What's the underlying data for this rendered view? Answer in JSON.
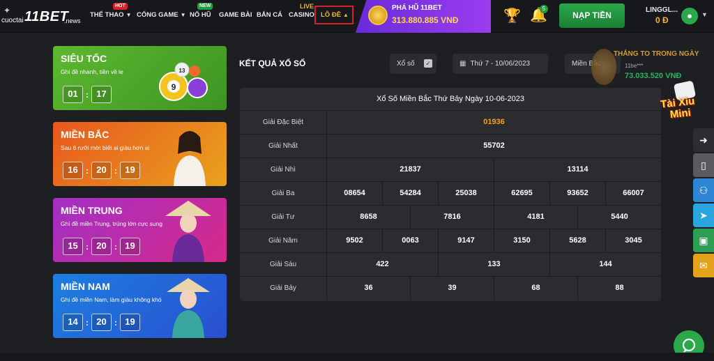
{
  "header": {
    "logo": {
      "prefix": "cuoctai",
      "brand": "11BET",
      "suffix": ".news"
    },
    "nav": [
      {
        "label": "THỂ THAO",
        "badge": "HOT",
        "caret": true
      },
      {
        "label": "CỔNG GAME",
        "caret": true
      },
      {
        "label": "NỔ HŨ",
        "badge": "NEW"
      },
      {
        "label": "GAME BÀI"
      },
      {
        "label": "BẮN CÁ"
      },
      {
        "label": "CASINO",
        "badge": "LIVE"
      },
      {
        "label": "LÔ ĐỀ",
        "caret_up": true,
        "selected": true
      }
    ],
    "jackpot": {
      "title": "PHÁ HŨ 11BET",
      "value": "313.880.885 VNĐ"
    },
    "notifications_count": "5",
    "deposit_label": "NẠP TIỀN",
    "user": {
      "name": "LINGGL...",
      "balance": "0 Đ"
    }
  },
  "regions": [
    {
      "name": "SIÊU TỐC",
      "subtitle": "Ghi đề nhanh, tiền về lẹ",
      "timer": [
        "01",
        "17"
      ],
      "color": "#4ea92a"
    },
    {
      "name": "MIỀN BẮC",
      "subtitle": "Sau 6 rưỡi mời biết ai giàu hơn ai",
      "timer": [
        "16",
        "20",
        "19"
      ],
      "color": "#e8701e"
    },
    {
      "name": "MIỀN TRUNG",
      "subtitle": "Ghi đề miền Trung, trúng lớn cực sung",
      "timer": [
        "15",
        "20",
        "19"
      ],
      "color": "#b42db0"
    },
    {
      "name": "MIỀN NAM",
      "subtitle": "Ghi đề miền Nam, làm giàu không khó",
      "timer": [
        "14",
        "20",
        "19"
      ],
      "color": "#2468d8"
    }
  ],
  "results": {
    "section_title": "KẾT QUẢ XỔ SỐ",
    "filters": {
      "type": "Xổ số",
      "date": "Thứ 7 - 10/06/2023",
      "region": "Miền Bắc"
    },
    "table_title": "Xổ Số Miền Bắc Thứ Bảy Ngày 10-06-2023",
    "rows": [
      {
        "label": "Giải Đặc Biệt",
        "values": [
          "01936"
        ],
        "special": true
      },
      {
        "label": "Giải Nhất",
        "values": [
          "55702"
        ]
      },
      {
        "label": "Giải Nhì",
        "values": [
          "21837",
          "13114"
        ]
      },
      {
        "label": "Giải Ba",
        "values": [
          "08654",
          "54284",
          "25038",
          "62695",
          "93652",
          "66007"
        ]
      },
      {
        "label": "Giải Tư",
        "values": [
          "8658",
          "7816",
          "4181",
          "5440"
        ]
      },
      {
        "label": "Giải Năm",
        "values": [
          "9502",
          "0063",
          "9147",
          "3150",
          "5628",
          "3045"
        ]
      },
      {
        "label": "Giải Sáu",
        "values": [
          "422",
          "133",
          "144"
        ]
      },
      {
        "label": "Giải Bảy",
        "values": [
          "36",
          "39",
          "68",
          "88"
        ]
      }
    ]
  },
  "win_widget": {
    "title": "THẮNG TO TRONG NGÀY",
    "user": "11be***",
    "amount": "73.033.520 VNĐ"
  },
  "taixiu": {
    "line1": "Tài Xỉu",
    "line2": "Mini"
  },
  "side_icons": [
    "arrow-right-icon",
    "phone-icon",
    "user-group-icon",
    "telegram-icon",
    "gift-icon",
    "mail-icon"
  ]
}
